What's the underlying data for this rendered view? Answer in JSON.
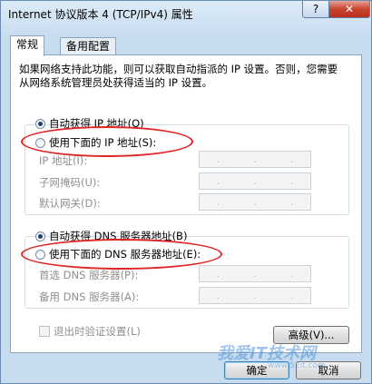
{
  "window": {
    "title": "Internet 协议版本 4 (TCP/IPv4) 属性",
    "help_label": "?",
    "close_label": "✕"
  },
  "tabs": [
    {
      "label": "常规",
      "active": true
    },
    {
      "label": "备用配置",
      "active": false
    }
  ],
  "description": "如果网络支持此功能，则可以获取自动指派的 IP 设置。否则，您需要从网络系统管理员处获得适当的 IP 设置。",
  "ip_section": {
    "auto_label": "自动获得 IP 地址(O)",
    "manual_label": "使用下面的 IP 地址(S):",
    "fields": [
      {
        "label": "IP 地址(I):"
      },
      {
        "label": "子网掩码(U):"
      },
      {
        "label": "默认网关(D):"
      }
    ]
  },
  "dns_section": {
    "auto_label": "自动获得 DNS 服务器地址(B)",
    "manual_label": "使用下面的 DNS 服务器地址(E):",
    "fields": [
      {
        "label": "首选 DNS 服务器(P):"
      },
      {
        "label": "备用 DNS 服务器(A):"
      }
    ]
  },
  "validate_on_exit_label": "退出时验证设置(L)",
  "buttons": {
    "advanced": "高级(V)...",
    "ok": "确定",
    "cancel": "取消"
  },
  "watermark": {
    "text": "我爱IT技术网",
    "sub": "www.52it.com"
  },
  "colors": {
    "highlight_ellipse": "#e02525"
  }
}
